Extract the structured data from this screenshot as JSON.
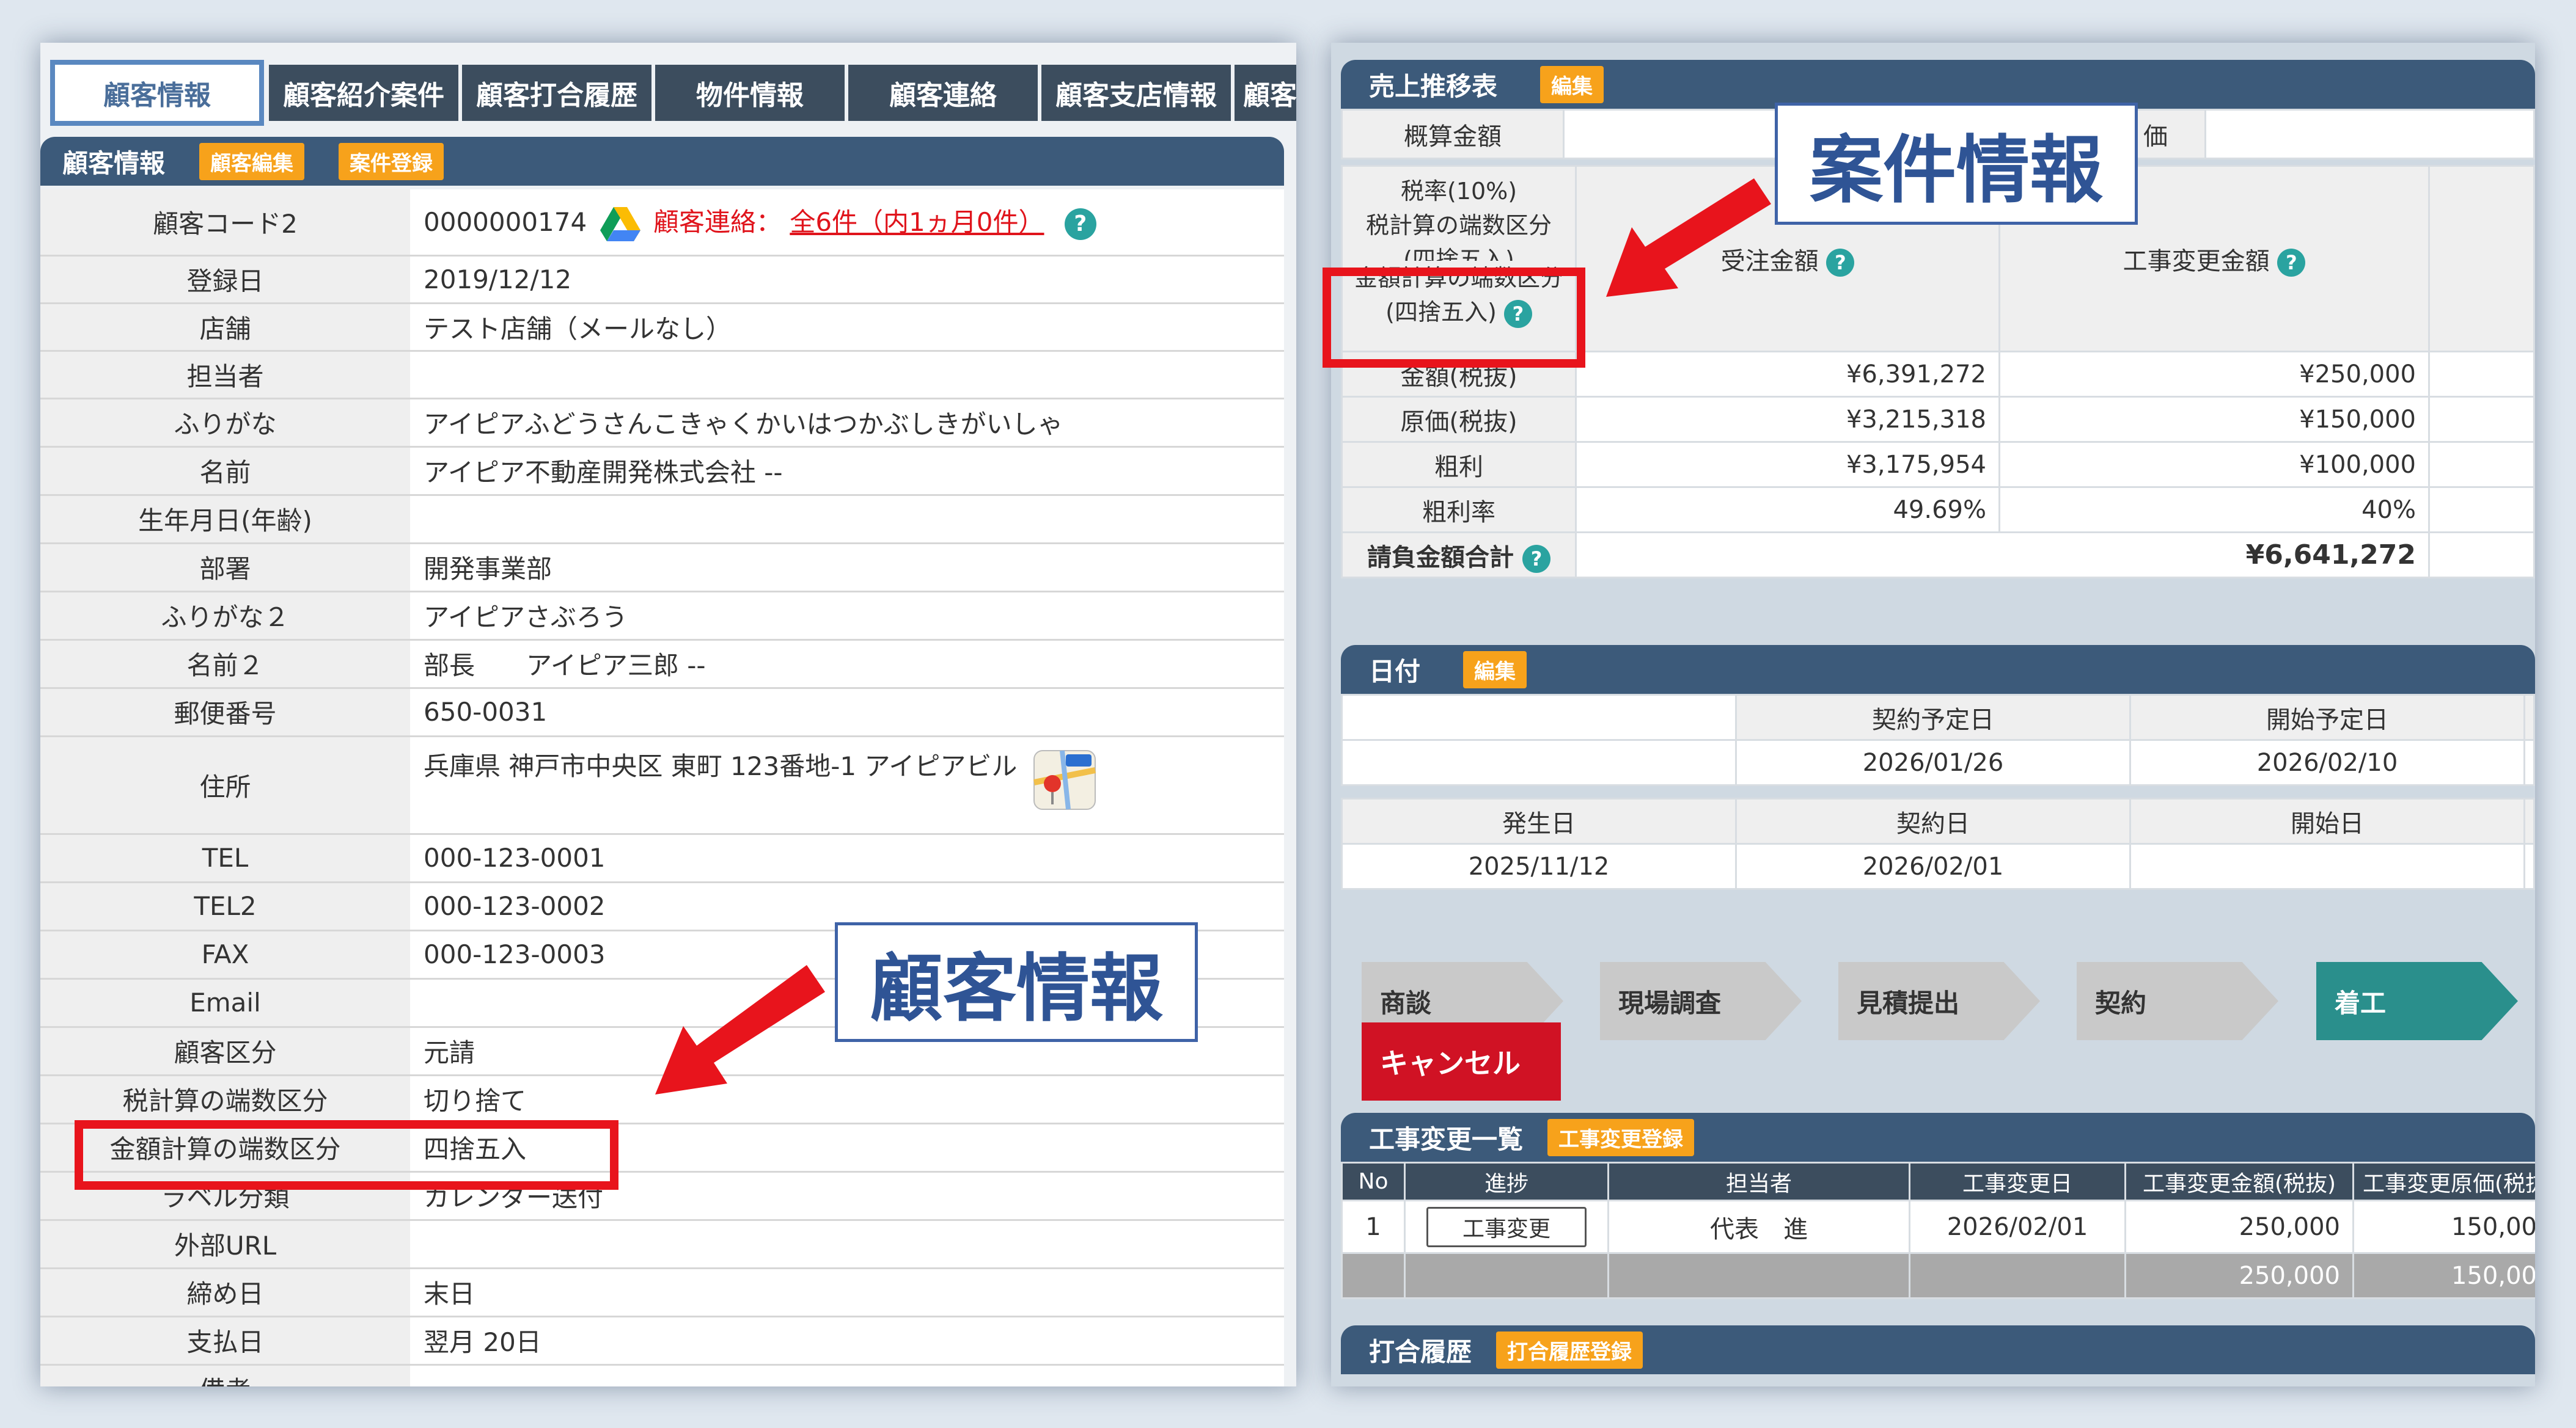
{
  "left": {
    "tabs": [
      "顧客情報",
      "顧客紹介案件",
      "顧客打合履歴",
      "物件情報",
      "顧客連絡",
      "顧客支店情報",
      "顧客"
    ],
    "section_title": "顧客情報",
    "btn_edit": "顧客編集",
    "btn_register": "案件登録",
    "contact_prefix": "顧客連絡：",
    "contact_link": "全6件（内1ヵ月0件）",
    "help_glyph": "?",
    "rows": [
      {
        "label": "顧客コード2",
        "value": "0000000174"
      },
      {
        "label": "登録日",
        "value": "2019/12/12"
      },
      {
        "label": "店舗",
        "value": "テスト店舗（メールなし）"
      },
      {
        "label": "担当者",
        "value": ""
      },
      {
        "label": "ふりがな",
        "value": "アイピアふどうさんこきゃくかいはつかぶしきがいしゃ"
      },
      {
        "label": "名前",
        "value": "アイピア不動産開発株式会社 --"
      },
      {
        "label": "生年月日(年齢)",
        "value": ""
      },
      {
        "label": "部署",
        "value": "開発事業部"
      },
      {
        "label": "ふりがな２",
        "value": "アイピアさぶろう"
      },
      {
        "label": "名前２",
        "value": "部長　　アイピア三郎 --"
      },
      {
        "label": "郵便番号",
        "value": "650-0031"
      },
      {
        "label": "住所",
        "value": "兵庫県 神戸市中央区 東町 123番地-1 アイピアビル"
      },
      {
        "label": "TEL",
        "value": "000-123-0001"
      },
      {
        "label": "TEL2",
        "value": "000-123-0002"
      },
      {
        "label": "FAX",
        "value": "000-123-0003"
      },
      {
        "label": "Email",
        "value": ""
      },
      {
        "label": "顧客区分",
        "value": "元請"
      },
      {
        "label": "税計算の端数区分",
        "value": "切り捨て"
      },
      {
        "label": "金額計算の端数区分",
        "value": "四捨五入"
      },
      {
        "label": "ラベル分類",
        "value": "カレンダー送付"
      },
      {
        "label": "外部URL",
        "value": ""
      },
      {
        "label": "締め日",
        "value": "末日"
      },
      {
        "label": "支払日",
        "value": "翌月 20日"
      },
      {
        "label": "備考",
        "value": ""
      }
    ],
    "callout": "顧客情報"
  },
  "right": {
    "sales_title": "売上推移表",
    "btn_edit": "編集",
    "estimate_label": "概算金額",
    "estimate_right_label": "価",
    "tax_label_1": "税率(10%)",
    "tax_label_2": "税計算の端数区分",
    "tax_label_3": "(四捨五入)",
    "amount_label_1": "金額計算の端数区分",
    "amount_label_2": "(四捨五入)",
    "col_order": "受注金額",
    "col_change": "工事変更金額",
    "sales_rows": [
      {
        "label": "金額(税抜)",
        "order": "¥6,391,272",
        "change": "¥250,000"
      },
      {
        "label": "原価(税抜)",
        "order": "¥3,215,318",
        "change": "¥150,000"
      },
      {
        "label": "粗利",
        "order": "¥3,175,954",
        "change": "¥100,000"
      },
      {
        "label": "粗利率",
        "order": "49.69%",
        "change": "40%"
      }
    ],
    "total_label": "請負金額合計",
    "total_value": "¥6,641,272",
    "callout": "案件情報",
    "date_title": "日付",
    "date_btn": "編集",
    "planned_contract_label": "契約予定日",
    "planned_contract": "2026/01/26",
    "planned_start_label": "開始予定日",
    "planned_start": "2026/02/10",
    "occur_label": "発生日",
    "occur": "2025/11/12",
    "contract_label": "契約日",
    "contract": "2026/02/01",
    "start_label": "開始日",
    "start": "",
    "steps": [
      "商談",
      "現場調査",
      "見積提出",
      "契約",
      "着工"
    ],
    "cancel": "キャンセル",
    "change_title": "工事変更一覧",
    "change_btn": "工事変更登録",
    "change_headers": [
      "No",
      "進捗",
      "担当者",
      "工事変更日",
      "工事変更金額(税抜)",
      "工事変更原価(税抜"
    ],
    "change_row": {
      "no": "1",
      "status": "工事変更",
      "person": "代表　進",
      "date": "2026/02/01",
      "amount": "250,000",
      "cost": "150,00"
    },
    "change_total": {
      "amount": "250,000",
      "cost": "150,00"
    },
    "meeting_title": "打合履歴",
    "meeting_btn": "打合履歴登録"
  }
}
